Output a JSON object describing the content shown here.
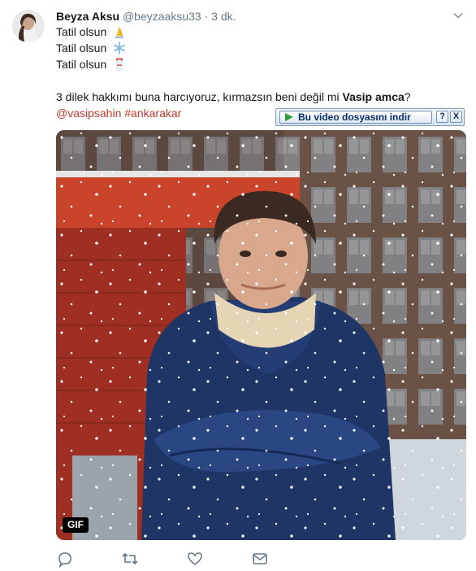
{
  "tweet": {
    "display_name": "Beyza Aksu",
    "handle": "@beyzaaksu33",
    "separator": "·",
    "time": "3 dk.",
    "lines": [
      "Tatil olsun",
      "Tatil olsun",
      "Tatil olsun"
    ],
    "line_emojis": [
      "folded-hands-emoji",
      "snowflake-emoji",
      "snowman-emoji"
    ],
    "sentence_start": "3 dilek hakkımı buna harcıyoruz, kırmazsın beni değil mi ",
    "sentence_bold": "Vasip amca",
    "sentence_end": "?",
    "mention": "@vasipsahin",
    "hashtag": "#ankarakar"
  },
  "download_bar": {
    "label": "Bu video dosyasını indir",
    "help": "?",
    "close": "X"
  },
  "media": {
    "badge": "GIF"
  },
  "colors": {
    "link": "#c0392b",
    "muted": "#657786",
    "text": "#14171a"
  }
}
